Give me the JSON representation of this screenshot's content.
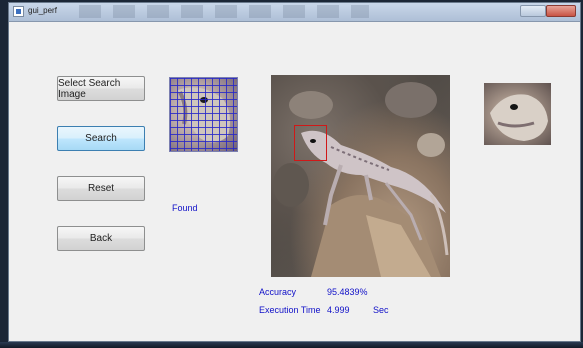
{
  "window": {
    "title": "gui_perf"
  },
  "buttons": {
    "select_search_image": "Select Search Image",
    "search": "Search",
    "reset": "Reset",
    "back": "Back"
  },
  "status": {
    "found_label": "Found"
  },
  "results": {
    "accuracy_label": "Accuracy",
    "accuracy_value": "95.4839%",
    "execution_time_label": "Execution Time",
    "execution_time_value": "4.999",
    "execution_time_unit": "Sec"
  },
  "colors": {
    "label_text": "#1010c8",
    "detection_box": "#d01818",
    "active_button": "#a7d9f5"
  }
}
